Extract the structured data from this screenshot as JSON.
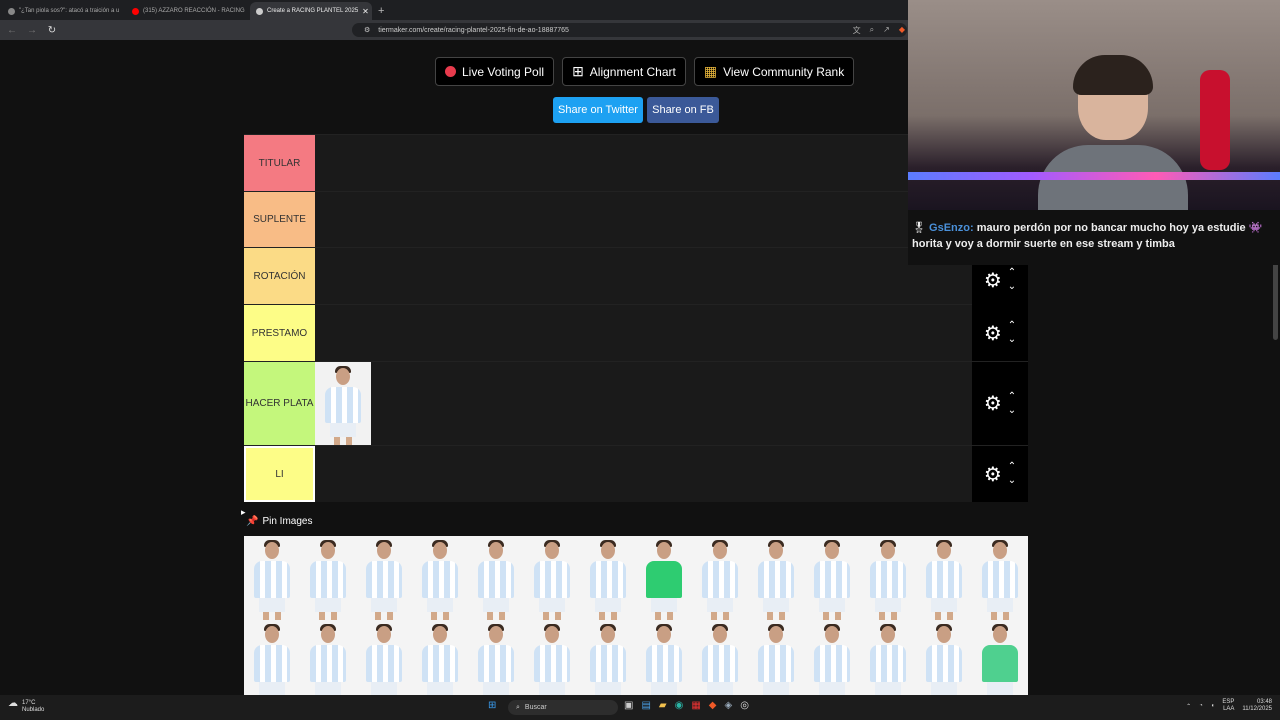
{
  "browser": {
    "tabs": [
      {
        "title": "\"¿Tan piola sos?\": atacó a traición a u",
        "dot_color": "#888888"
      },
      {
        "title": "(315) AZZARO REACCIÓN - RACING",
        "dot_color": "#ff0000"
      },
      {
        "title": "Create a RACING PLANTEL 2025",
        "dot_color": "#cccccc"
      }
    ],
    "url": "tiermaker.com/create/racing-plantel-2025-fin-de-ao-18887765"
  },
  "toolbar": {
    "live_voting": "Live Voting Poll",
    "alignment": "Alignment Chart",
    "community": "View Community Rank",
    "share_twitter": "Share on Twitter",
    "share_fb": "Share on FB"
  },
  "tiers": [
    {
      "label": "TITULAR",
      "color": "#f47a82"
    },
    {
      "label": "SUPLENTE",
      "color": "#f8bc86"
    },
    {
      "label": "ROTACIÓN",
      "color": "#fbdb86"
    },
    {
      "label": "PRESTAMO",
      "color": "#fdfd87"
    },
    {
      "label": "HACER PLATA",
      "color": "#c4f77c"
    },
    {
      "label": "LI",
      "color": "#fdfd87"
    }
  ],
  "pin_images": "Pin Images",
  "chat": {
    "user": "GsEnzo:",
    "message": "mauro perdón por no bancar mucho hoy ya estudie 👾 horita y voy a dormir suerte en ese stream y timba"
  },
  "taskbar": {
    "temp": "17°C",
    "condition": "Nublado",
    "search": "Buscar",
    "lang": "ESP",
    "lang2": "LAA",
    "time": "03:48",
    "date": "11/12/2025"
  }
}
